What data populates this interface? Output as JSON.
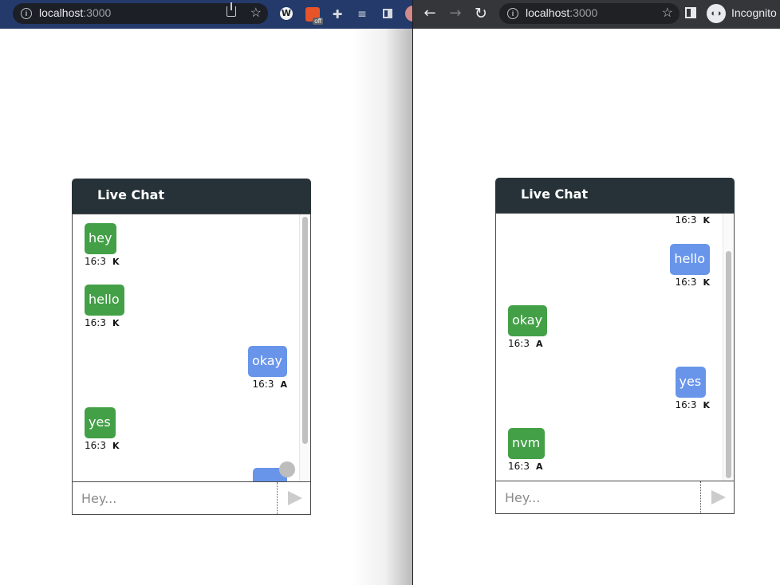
{
  "left_window": {
    "address_bar": {
      "host": "localhost",
      "port": ":3000"
    },
    "extensions": [
      {
        "icon": "w-extension-icon",
        "glyph": "W"
      },
      {
        "icon": "extension-off-icon",
        "badge": "off"
      },
      {
        "icon": "puzzle-icon"
      },
      {
        "icon": "media-queue-icon"
      },
      {
        "icon": "side-panel-icon"
      }
    ],
    "chat": {
      "title": "Live Chat",
      "messages": [
        {
          "text": "hey",
          "time": "16:3",
          "author": "K",
          "side": "them",
          "color": "#43a047"
        },
        {
          "text": "hello",
          "time": "16:3",
          "author": "K",
          "side": "them",
          "color": "#43a047"
        },
        {
          "text": "okay",
          "time": "16:3",
          "author": "A",
          "side": "me",
          "color": "#6895ea"
        },
        {
          "text": "yes",
          "time": "16:3",
          "author": "K",
          "side": "them",
          "color": "#43a047"
        }
      ],
      "input_placeholder": "Hey..."
    }
  },
  "right_window": {
    "address_bar": {
      "host": "localhost",
      "port": ":3000"
    },
    "profile_label": "Incognito",
    "chat": {
      "title": "Live Chat",
      "messages": [
        {
          "text": "",
          "time": "16:3",
          "author": "K",
          "side": "me"
        },
        {
          "text": "hello",
          "time": "16:3",
          "author": "K",
          "side": "me",
          "color": "#6895ea"
        },
        {
          "text": "okay",
          "time": "16:3",
          "author": "A",
          "side": "them",
          "color": "#43a047"
        },
        {
          "text": "yes",
          "time": "16:3",
          "author": "K",
          "side": "me",
          "color": "#6895ea"
        },
        {
          "text": "nvm",
          "time": "16:3",
          "author": "A",
          "side": "them",
          "color": "#43a047"
        }
      ],
      "input_placeholder": "Hey..."
    }
  },
  "colors": {
    "header": "#263238",
    "received_bubble": "#43a047",
    "sent_bubble": "#6895ea"
  }
}
